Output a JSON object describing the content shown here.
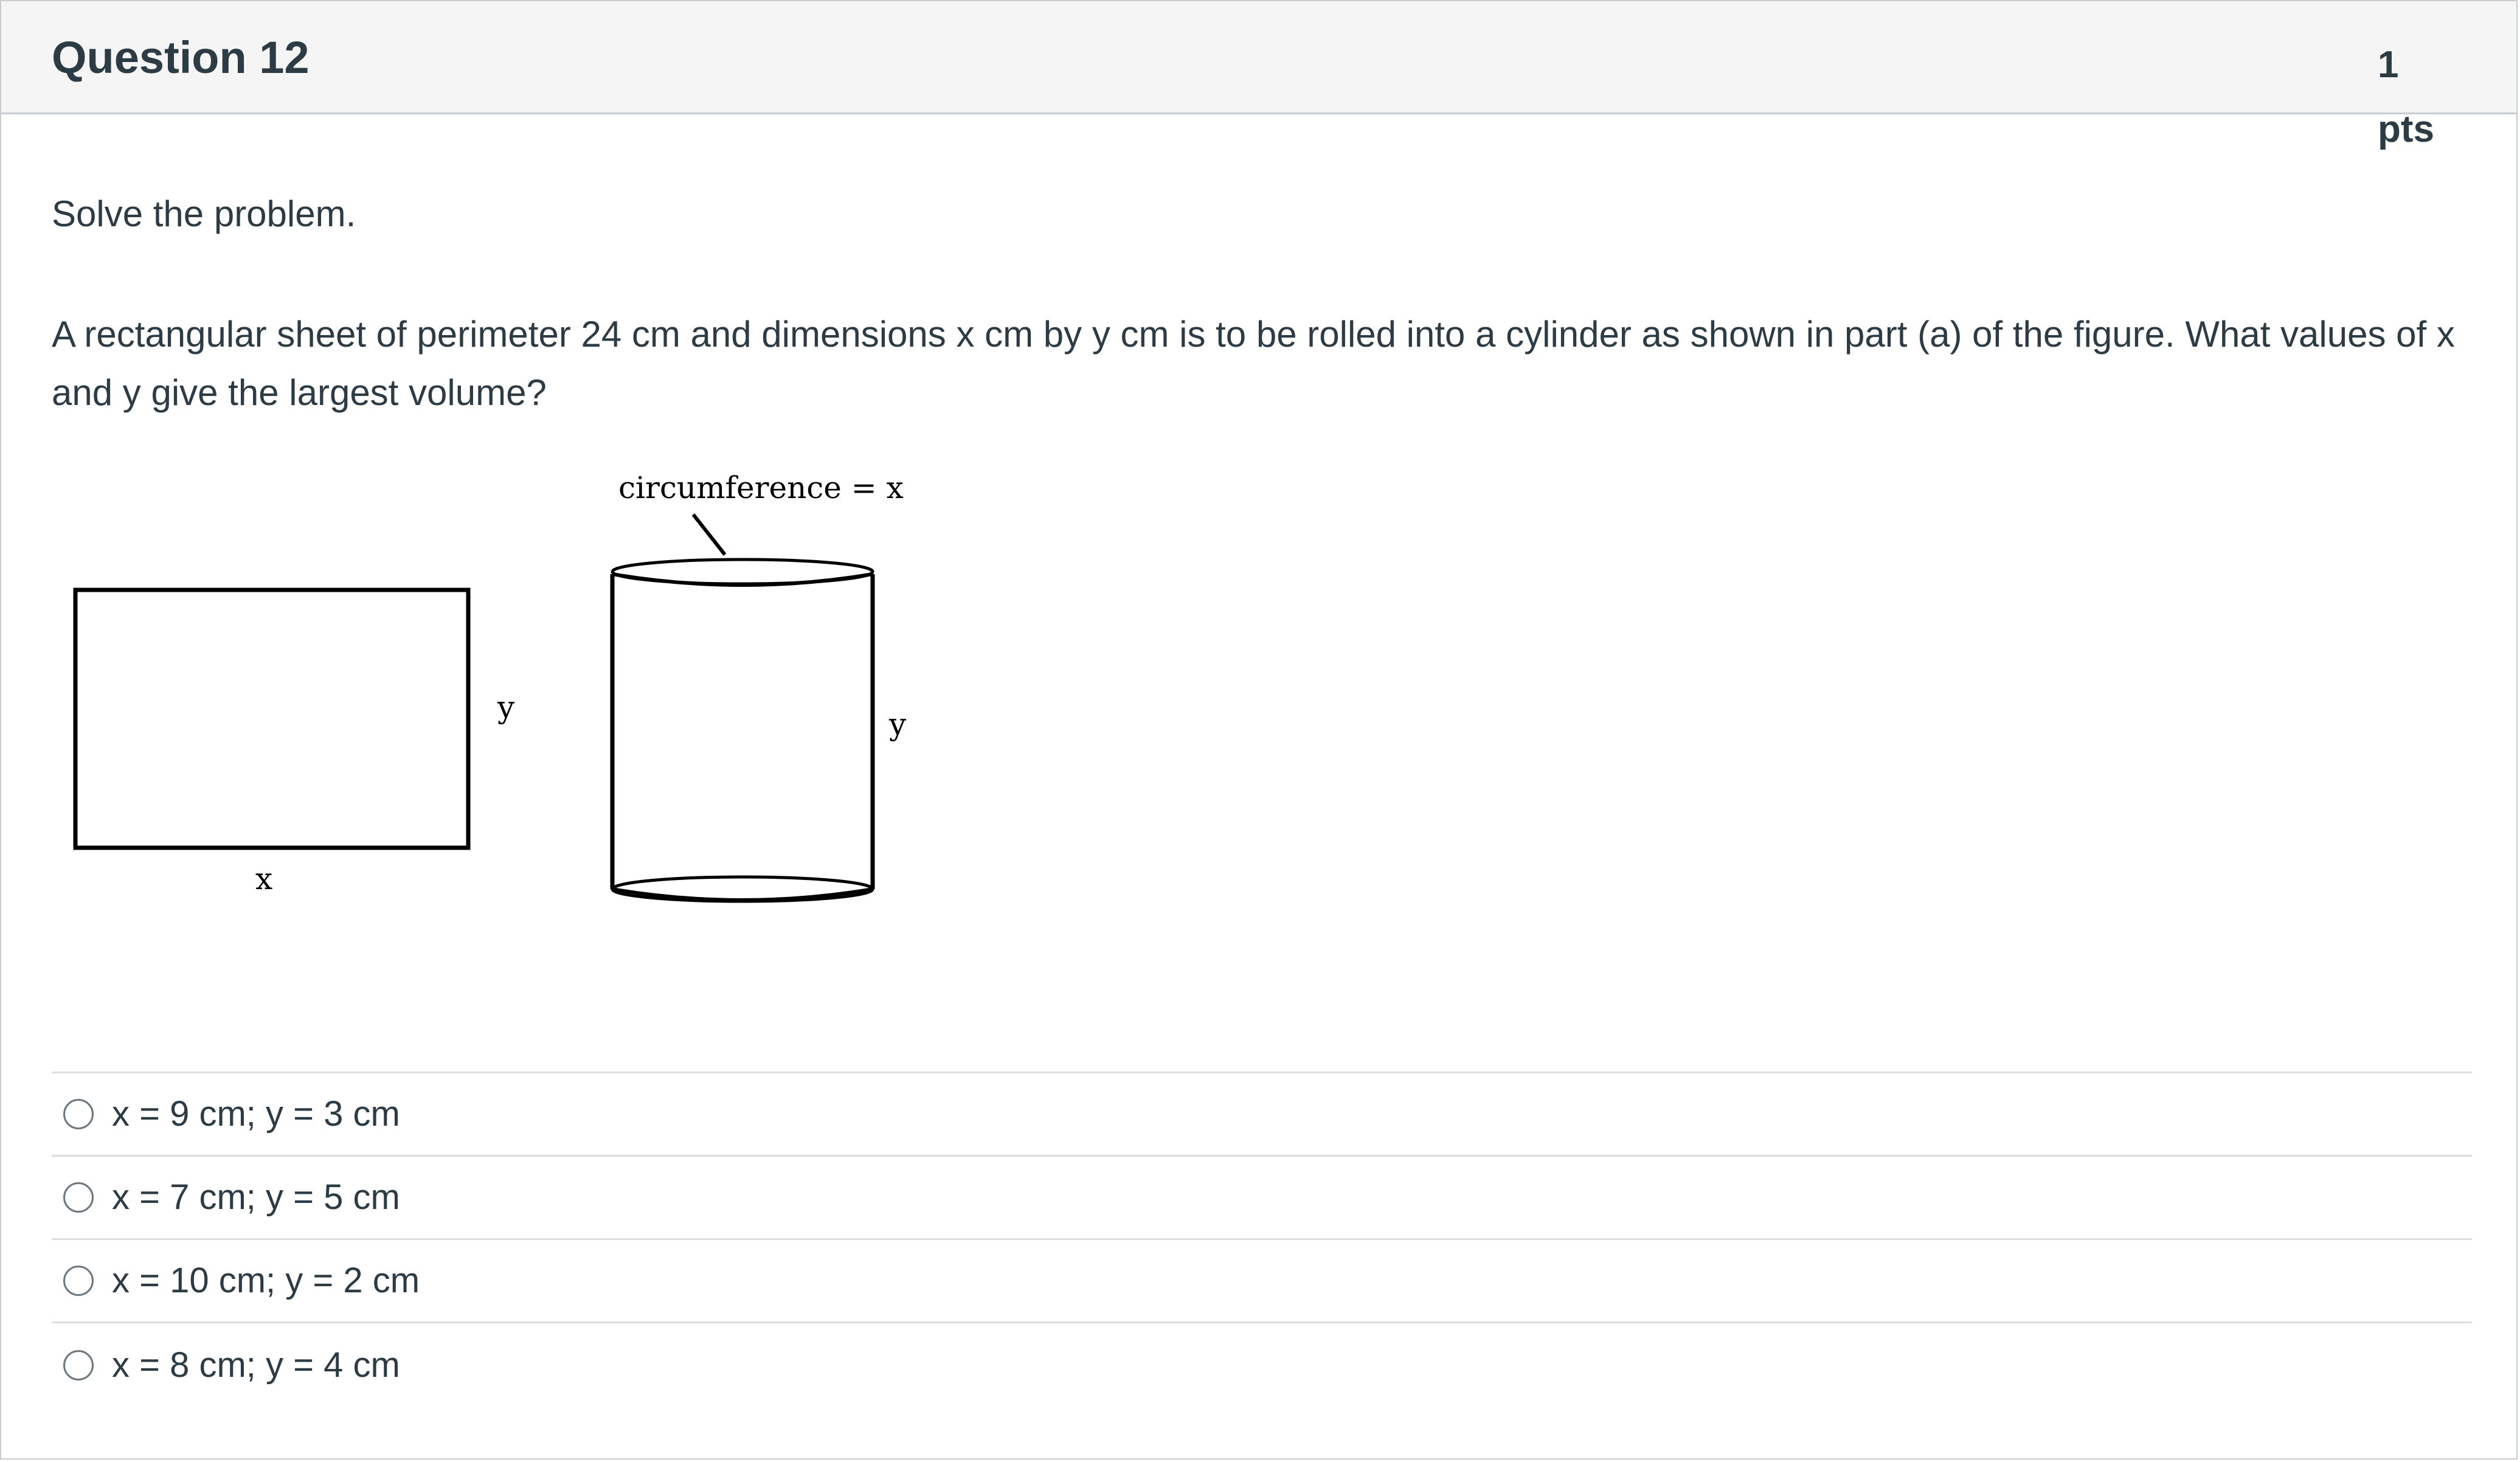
{
  "question": {
    "title": "Question 12",
    "points": "1 pts",
    "instructions": "Solve the problem.",
    "text": "A rectangular sheet of perimeter 24 cm and dimensions x cm by y cm is to be rolled into a cylinder as shown in part (a) of the figure. What values of x and y give the largest volume?"
  },
  "figure": {
    "rect_width_label": "x",
    "rect_height_label": "y",
    "cylinder_circumference_label": "circumference = x",
    "cylinder_height_label": "y"
  },
  "answers": [
    {
      "label": "x = 9 cm; y = 3 cm",
      "selected": false
    },
    {
      "label": "x = 7 cm; y = 5 cm",
      "selected": false
    },
    {
      "label": "x = 10 cm; y = 2 cm",
      "selected": false
    },
    {
      "label": "x = 8 cm; y = 4 cm",
      "selected": false
    }
  ]
}
